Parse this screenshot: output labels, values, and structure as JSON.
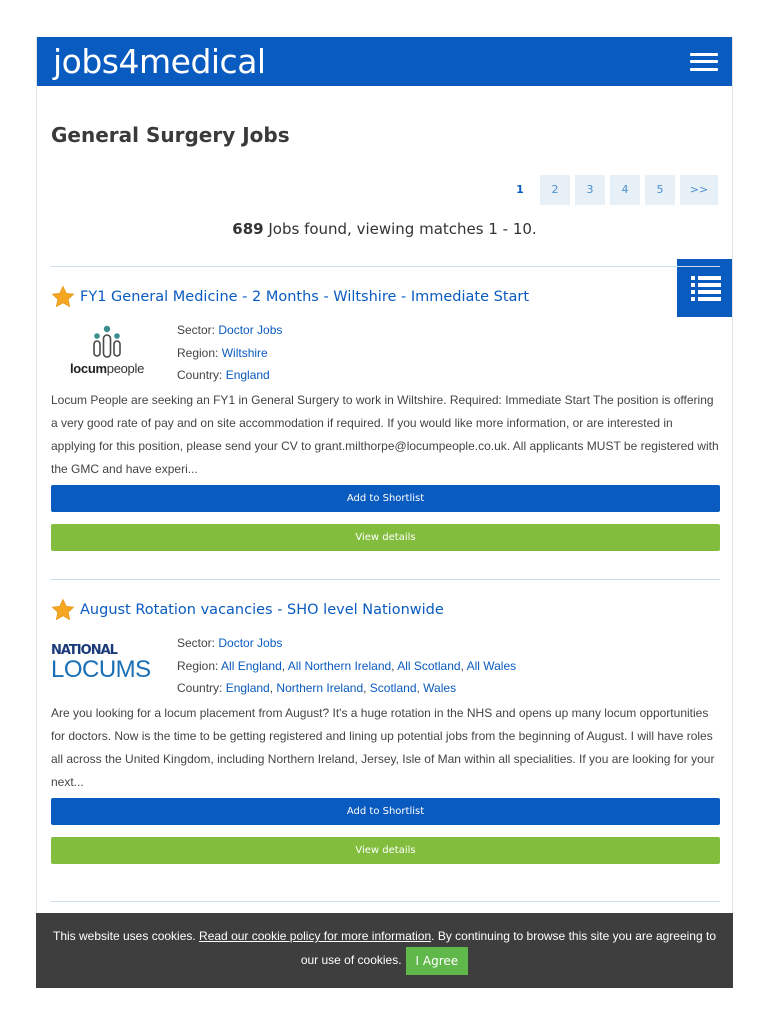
{
  "header": {
    "logo": "jobs4medical"
  },
  "page_title": "General Surgery Jobs",
  "pagination": {
    "pages": [
      "1",
      "2",
      "3",
      "4",
      "5"
    ],
    "next": ">>"
  },
  "results": {
    "count": "689",
    "text": " Jobs found, viewing matches 1 - 10."
  },
  "labels": {
    "sector": "Sector: ",
    "region": "Region: ",
    "country": "Country: "
  },
  "jobs": [
    {
      "title": "FY1 General Medicine - 2 Months - Wiltshire - Immediate Start",
      "logo_text_bold": "locum",
      "logo_text": "people",
      "sector": "Doctor Jobs",
      "region": "Wiltshire",
      "country": "England",
      "description": "Locum People are seeking an FY1 in General Surgery to work in Wiltshire. Required: Immediate Start The position is offering a very good rate of pay and on site accommodation if required. If you would like more information, or are interested in applying for this position, please send your CV to grant.milthorpe@locumpeople.co.uk. All applicants MUST be registered with the GMC and have experi...",
      "shortlist_label": "Add to Shortlist",
      "details_label": "View details"
    },
    {
      "title": "August Rotation vacancies - SHO level Nationwide",
      "logo_text_top": "NATIONAL",
      "logo_text_bottom": "LOCUMS",
      "sector": "Doctor Jobs",
      "regions": [
        "All England",
        "All Northern Ireland",
        "All Scotland",
        "All Wales"
      ],
      "countries": [
        "England",
        "Northern Ireland",
        "Scotland",
        "Wales"
      ],
      "description": "Are you looking for a locum placement from August? It's a huge rotation in the NHS and opens up many locum opportunities for doctors. Now is the time to be getting registered and lining up potential jobs from the beginning of August. I will have roles all across the United Kingdom, including Northern Ireland, Jersey, Isle of Man within all specialities. If you are looking for your next...",
      "shortlist_label": "Add to Shortlist",
      "details_label": "View details"
    }
  ],
  "cookie": {
    "text_before": "This website uses cookies. ",
    "link": "Read our cookie policy for more information",
    "text_after": ". By continuing to browse this site you are agreeing to our use of cookies.",
    "agree": "I Agree"
  },
  "colors": {
    "brand": "#0a5bbf",
    "details_button": "#82bd3e",
    "agree_button": "#61b84a",
    "cookie_bar": "#3e3e3e",
    "star": "#f5a623"
  }
}
